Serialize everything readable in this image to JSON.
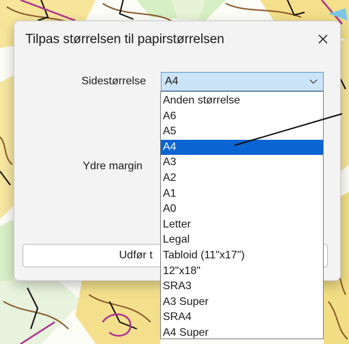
{
  "dialog": {
    "title": "Tilpas størrelsen til papirstørrelsen",
    "close_icon": "close-icon"
  },
  "form": {
    "page_size_label": "Sidestørrelse",
    "page_size_value": "A4",
    "outer_margin_label": "Ydre margin",
    "run_button_label": "Udfør t"
  },
  "dropdown": {
    "options": [
      "Anden størrelse",
      "A6",
      "A5",
      "A4",
      "A3",
      "A2",
      "A1",
      "A0",
      "Letter",
      "Legal",
      "Tabloid (11\"x17\")",
      "12\"x18\"",
      "SRA3",
      "A3 Super",
      "SRA4",
      "A4 Super"
    ],
    "selected": "A4"
  },
  "colors": {
    "selection": "#0a64d2",
    "select_field": "#cce4f7",
    "dialog_bg": "#f3f3f3"
  }
}
